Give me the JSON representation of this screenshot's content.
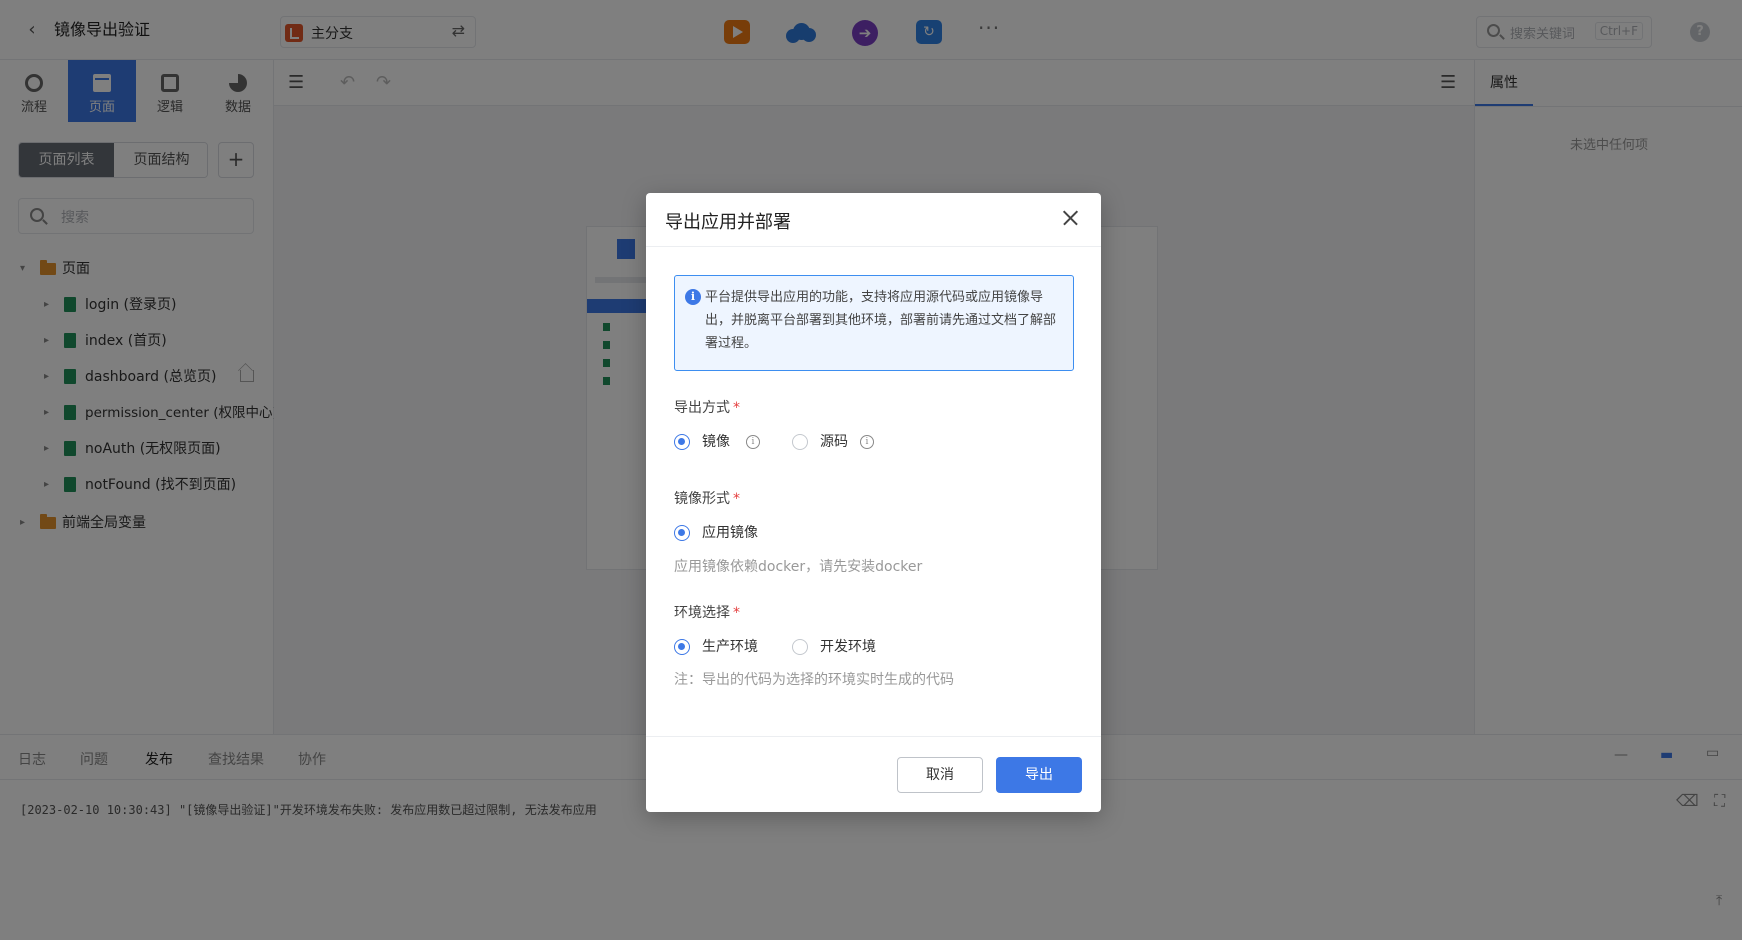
{
  "header": {
    "back_icon": "chevron-left-icon",
    "title": "镜像导出验证",
    "branch": "主分支",
    "swap_icon": "swap-icon",
    "search_placeholder": "搜索关键词",
    "search_shortcut": "Ctrl+F",
    "help": "?",
    "more": "···"
  },
  "nav_tabs": [
    {
      "label": "流程",
      "icon": "flow-icon"
    },
    {
      "label": "页面",
      "icon": "page-icon",
      "active": true
    },
    {
      "label": "逻辑",
      "icon": "logic-icon"
    },
    {
      "label": "数据",
      "icon": "data-icon"
    }
  ],
  "left_panel": {
    "segment": [
      "页面列表",
      "页面结构"
    ],
    "add": "+",
    "search_placeholder": "搜索",
    "tree": [
      {
        "label": "页面",
        "type": "folder",
        "expanded": true
      },
      {
        "label": "login (登录页)",
        "type": "page"
      },
      {
        "label": "index (首页)",
        "type": "page"
      },
      {
        "label": "dashboard (总览页)",
        "type": "page",
        "home": true
      },
      {
        "label": "permission_center (权限中心)",
        "type": "page"
      },
      {
        "label": "noAuth (无权限页面)",
        "type": "page"
      },
      {
        "label": "notFound (找不到页面)",
        "type": "page"
      },
      {
        "label": "前端全局变量",
        "type": "folder",
        "expanded": false
      }
    ]
  },
  "right_panel": {
    "tab": "属性",
    "empty": "未选中任何项"
  },
  "bottom": {
    "tabs": [
      "日志",
      "问题",
      "发布",
      "查找结果",
      "协作"
    ],
    "active_tab": "发布",
    "log": "[2023-02-10 10:30:43] \"[镜像导出验证]\"开发环境发布失败: 发布应用数已超过限制, 无法发布应用"
  },
  "modal": {
    "title": "导出应用并部署",
    "notice": "平台提供导出应用的功能，支持将应用源代码或应用镜像导出，并脱离平台部署到其他环境，部署前请先通过文档了解部署过程。",
    "export_mode": {
      "label": "导出方式",
      "required": "*",
      "options": [
        "镜像",
        "源码"
      ],
      "selected": "镜像"
    },
    "image_form": {
      "label": "镜像形式",
      "required": "*",
      "options": [
        "应用镜像"
      ],
      "selected": "应用镜像",
      "hint": "应用镜像依赖docker，请先安装docker"
    },
    "environment": {
      "label": "环境选择",
      "required": "*",
      "options": [
        "生产环境",
        "开发环境"
      ],
      "selected": "生产环境",
      "hint": "注：导出的代码为选择的环境实时生成的代码"
    },
    "cancel": "取消",
    "confirm": "导出"
  },
  "colors": {
    "primary": "#3d78e6",
    "required": "#e43d3d",
    "notice_bg": "#eef5ff",
    "notice_border": "#3d8ef0"
  }
}
